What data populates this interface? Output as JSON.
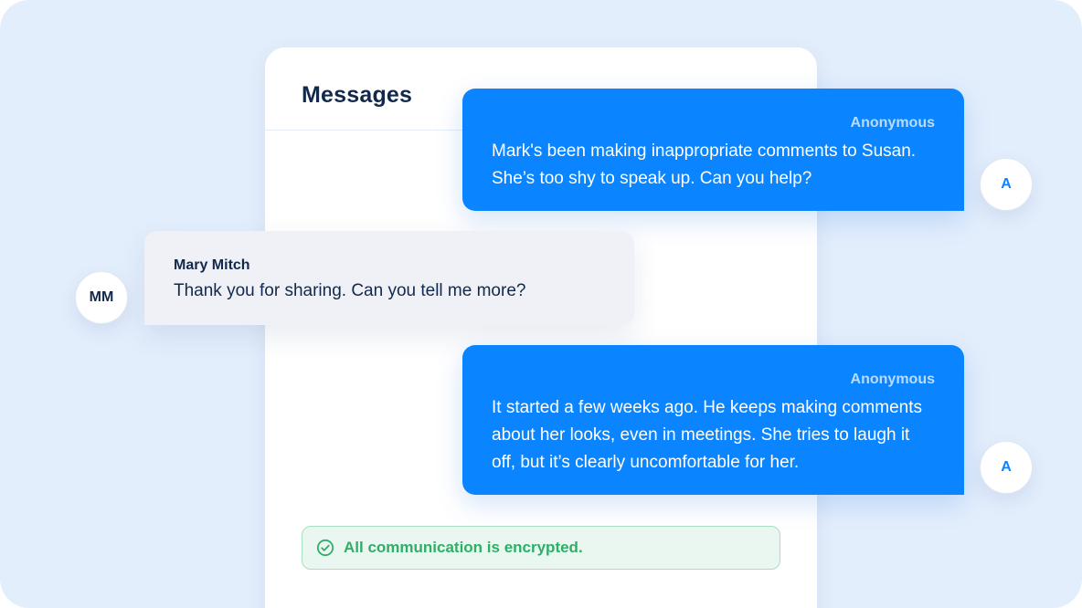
{
  "panel": {
    "title": "Messages"
  },
  "messages": [
    {
      "sender": "Anonymous",
      "text": "Mark's been making inappropriate comments to Susan. She’s too shy to speak up. Can you help?",
      "avatar": "A",
      "direction": "outgoing"
    },
    {
      "sender": "Mary Mitch",
      "text": "Thank you for sharing. Can you tell me more?",
      "avatar": "MM",
      "direction": "incoming"
    },
    {
      "sender": "Anonymous",
      "text": "It started a few weeks ago. He keeps making comments about her looks, even in meetings. She tries to laugh it off, but it’s clearly uncomfortable for her.",
      "avatar": "A",
      "direction": "outgoing"
    }
  ],
  "encryption_notice": {
    "label": "All communication is encrypted.",
    "icon": "check-circle-icon"
  },
  "colors": {
    "background": "#e3eefc",
    "accent": "#0a84ff",
    "text_dark": "#13294b",
    "success": "#2fae68",
    "success_bg": "#e9f7f0"
  }
}
